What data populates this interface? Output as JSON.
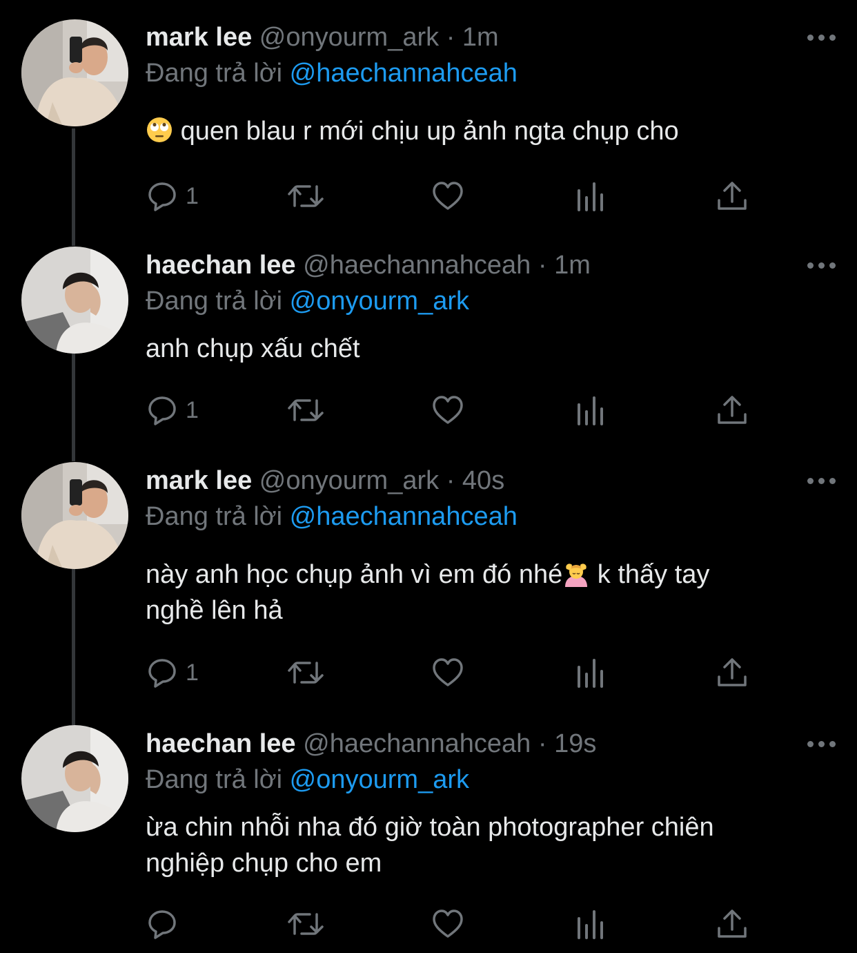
{
  "reply_prefix": "Đang trả lời",
  "dot": "·",
  "tweets": [
    {
      "name": "mark lee",
      "handle": "@onyourm_ark",
      "time": "1m",
      "reply_to": "@haechannahceah",
      "text": "quen blau r mới chịu up ảnh ngta chụp cho",
      "text_line2": "",
      "leading_emoji": "face-with-rolling-eyes",
      "reply_count": "1"
    },
    {
      "name": "haechan lee",
      "handle": "@haechannahceah",
      "time": "1m",
      "reply_to": "@onyourm_ark",
      "text": "anh chụp xấu chết",
      "text_line2": "",
      "reply_count": "1"
    },
    {
      "name": "mark lee",
      "handle": "@onyourm_ark",
      "time": "40s",
      "reply_to": "@haechannahceah",
      "text": "này anh học chụp ảnh vì em đó nhé",
      "text_after_emoji": " k thấy tay",
      "inline_emoji": "person-getting-massage",
      "text_line2": "nghề lên hả",
      "reply_count": "1"
    },
    {
      "name": "haechan lee",
      "handle": "@haechannahceah",
      "time": "19s",
      "reply_to": "@onyourm_ark",
      "text": "ừa chin nhỗi nha đó giờ toàn photographer chiên",
      "text_line2": "nghiệp chụp cho em",
      "reply_count": ""
    }
  ],
  "icons": {
    "reply": "reply-bubble-icon",
    "retweet": "retweet-icon",
    "like": "heart-icon",
    "views": "views-bar-chart-icon",
    "share": "share-upload-icon",
    "more": "more-dots-icon"
  },
  "colors": {
    "background": "#000000",
    "primary_text": "#e7e9ea",
    "secondary_text": "#71767b",
    "mention": "#1d9bf0",
    "thread_line": "#333639"
  }
}
